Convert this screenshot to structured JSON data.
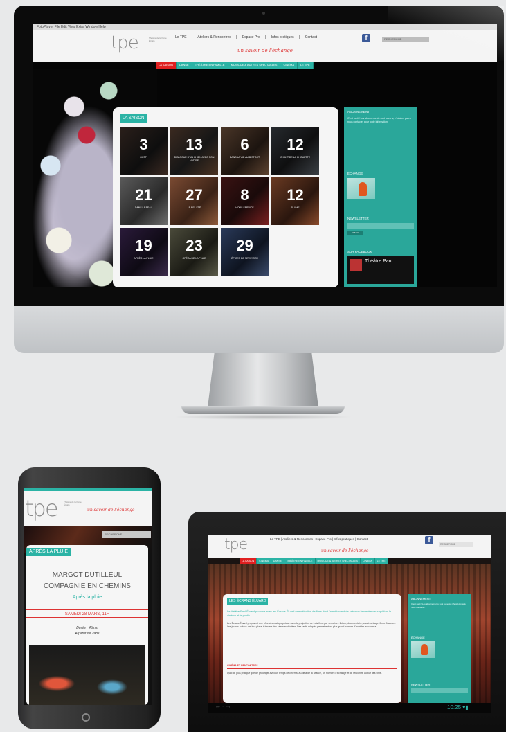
{
  "desktop": {
    "menubar": "  FotoPlayer   File   Edit   View   Extra   Window   Help",
    "logo": "tpe",
    "tagline": "Théâtre de la Porte Étroite",
    "nav": [
      "Le TPE",
      "|",
      "Ateliers & Rencontres",
      "|",
      "Espace Pro",
      "|",
      "Infos pratiques",
      "|",
      "Contact"
    ],
    "script_tagline": "un savoir de l'échange",
    "search_placeholder": "RECHERCHE",
    "subnav": [
      "LA SAISON",
      "DANSE",
      "THÉÂTRE EN FAMILLE",
      "MUSIQUE & AUTRES SPECTACLES",
      "CINÉMA",
      "LE TPE"
    ],
    "season_title": "LA SAISON",
    "tiles": [
      {
        "num": "3",
        "cap": "GOTTI"
      },
      {
        "num": "13",
        "cap": "DIALOGUE D'UN CHIEN AVEC SON MAÎTRE"
      },
      {
        "num": "6",
        "cap": "DANS LA VIE AU BISTROT"
      },
      {
        "num": "12",
        "cap": "CHANT DE LA CHOUETTE"
      },
      {
        "num": "21",
        "cap": "DANS LA PEAU"
      },
      {
        "num": "27",
        "cap": "LE BEL ÉTÉ"
      },
      {
        "num": "8",
        "cap": "HORS SERVICE"
      },
      {
        "num": "12",
        "cap": "PLUME"
      },
      {
        "num": "19",
        "cap": "APRÈS LA PLUIE"
      },
      {
        "num": "23",
        "cap": "OPÉRA DE LA PLUIE"
      },
      {
        "num": "29",
        "cap": "ÉPICES DE NEW YORK"
      }
    ],
    "sidebar": {
      "block1_title": "ABONNEMENT",
      "block1_text": "C'est parti ! Les abonnements sont ouverts, n'hésitez pas à nous contacter pour toute information.",
      "block2_title": "ÉCHANGE",
      "block3_title": "NEWSLETTER",
      "newsletter_field": "E-MAIL",
      "newsletter_button": "ENVOI",
      "block4_title": "SUR FACEBOOK",
      "fb_name": "Théâtre Pau..."
    }
  },
  "phone": {
    "logo": "tpe",
    "tagline": "Théâtre de la Porte Étroite",
    "script_tagline": "un savoir de l'échange",
    "search_placeholder": "RECHERCHE",
    "label": "APRÈS LA PLUIE",
    "title_line1": "MARGOT DUTILLEUL",
    "title_line2": "COMPAGNIE EN CHEMINS",
    "subtitle": "Après la pluie",
    "date": "SAMEDI 28 MARS, 11H",
    "duration_line1": "Durée : 45min",
    "duration_line2": "A partir de 2ans"
  },
  "tablet": {
    "logo": "tpe",
    "nav": "Le TPE  |  Ateliers & Rencontres  |  Espace Pro  |  Infos pratiques  |  Contact",
    "script_tagline": "un savoir de l'échange",
    "search_placeholder": "RECHERCHE",
    "subnav": [
      "LA SAISON",
      "CINÉMA",
      "DANSE",
      "THÉÂTRE EN FAMILLE",
      "MUSIQUE & AUTRES SPECTACLES",
      "CINÉMA",
      "LE TPE"
    ],
    "label": "LES ÉCRANS ÉLUARD",
    "lead": "Le théâtre Paul Éluard propose avec les Écrans Éluard une sélection de films dont l'ambition est de créer un lien entre ceux qui font le cinéma et le public.",
    "body": "Les Écrans Éluard proposent une offre cinématographique avec la projection de trois films par semaine : fiction, documentaire, court-métrage, films d'auteurs. Les jeunes publics ont leur place à travers des séances dédiées. Des tarifs adaptés permettent au plus grand nombre d'accéder au cinéma.",
    "section": "CINÉMA ET RENCONTRES",
    "body2": "Quoi de plus pratique que de prolonger avec un temps de cinéma, au-delà de la séance, un moment d'échange et de rencontre autour des films.",
    "sb_title": "ABONNEMENT",
    "sb_text": "C'est parti ! Les abonnements sont ouverts, n'hésitez pas à nous contacter.",
    "sb_title2": "ÉCHANGE",
    "sb_title3": "NEWSLETTER",
    "android_icons": "↩   ⌂   ▭",
    "clock": "10:25 ▾▮"
  }
}
